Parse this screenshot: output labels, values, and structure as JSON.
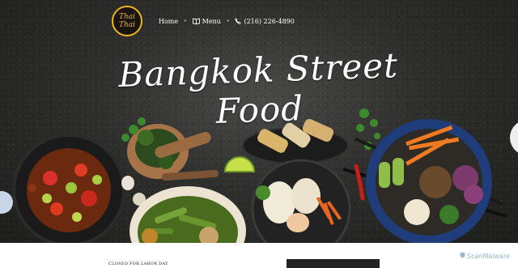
{
  "logo": {
    "line1": "Thai",
    "line2": "Thai"
  },
  "nav": {
    "home": "Home",
    "menu": "Menu",
    "phone": "(216) 226-4890",
    "separator": "•"
  },
  "hero": {
    "title": "Bangkok Street Food"
  },
  "notice": {
    "text": "CLOSED FOR LABOR DAY"
  },
  "watermark": {
    "text": "ScanMalware"
  },
  "colors": {
    "logo_ring": "#e8b81e",
    "hero_bg": "#2e2e2d",
    "nav_text": "#ffffff"
  }
}
